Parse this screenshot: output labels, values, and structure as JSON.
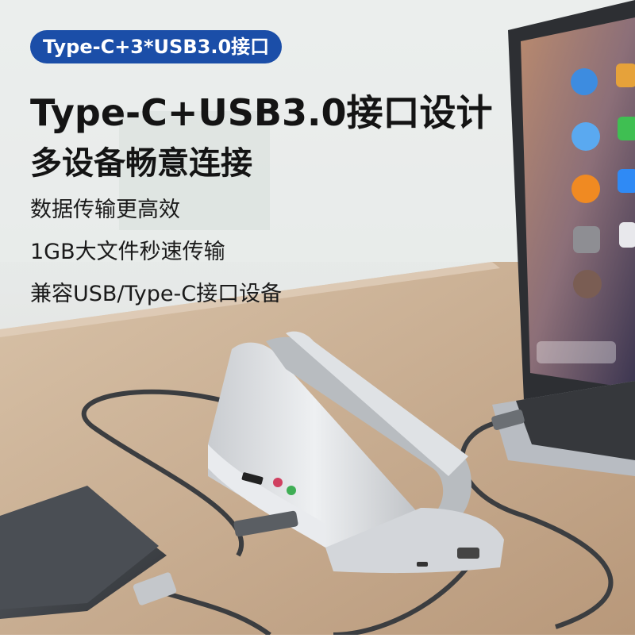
{
  "badge": {
    "text": "Type-C+3*USB3.0接口"
  },
  "headline": {
    "line1": "Type-C+USB3.0接口设计",
    "line2": "多设备畅意连接"
  },
  "features": [
    "数据传输更高效",
    "1GB大文件秒速传输",
    "兼容USB/Type-C接口设备"
  ],
  "colors": {
    "badge_bg": "#1b4ea8",
    "text_dark": "#141414",
    "desk": "#c8aa8c",
    "laptop_body": "#3a3d42",
    "stand_silver": "#dcdfe3"
  },
  "icons": [
    "safari-icon",
    "photos-icon",
    "messages-icon",
    "facetime-icon",
    "finder-icon",
    "appstore-icon",
    "ibooks-icon",
    "music-icon",
    "calculator-icon",
    "siri-icon",
    "macos-mojave-icon"
  ]
}
